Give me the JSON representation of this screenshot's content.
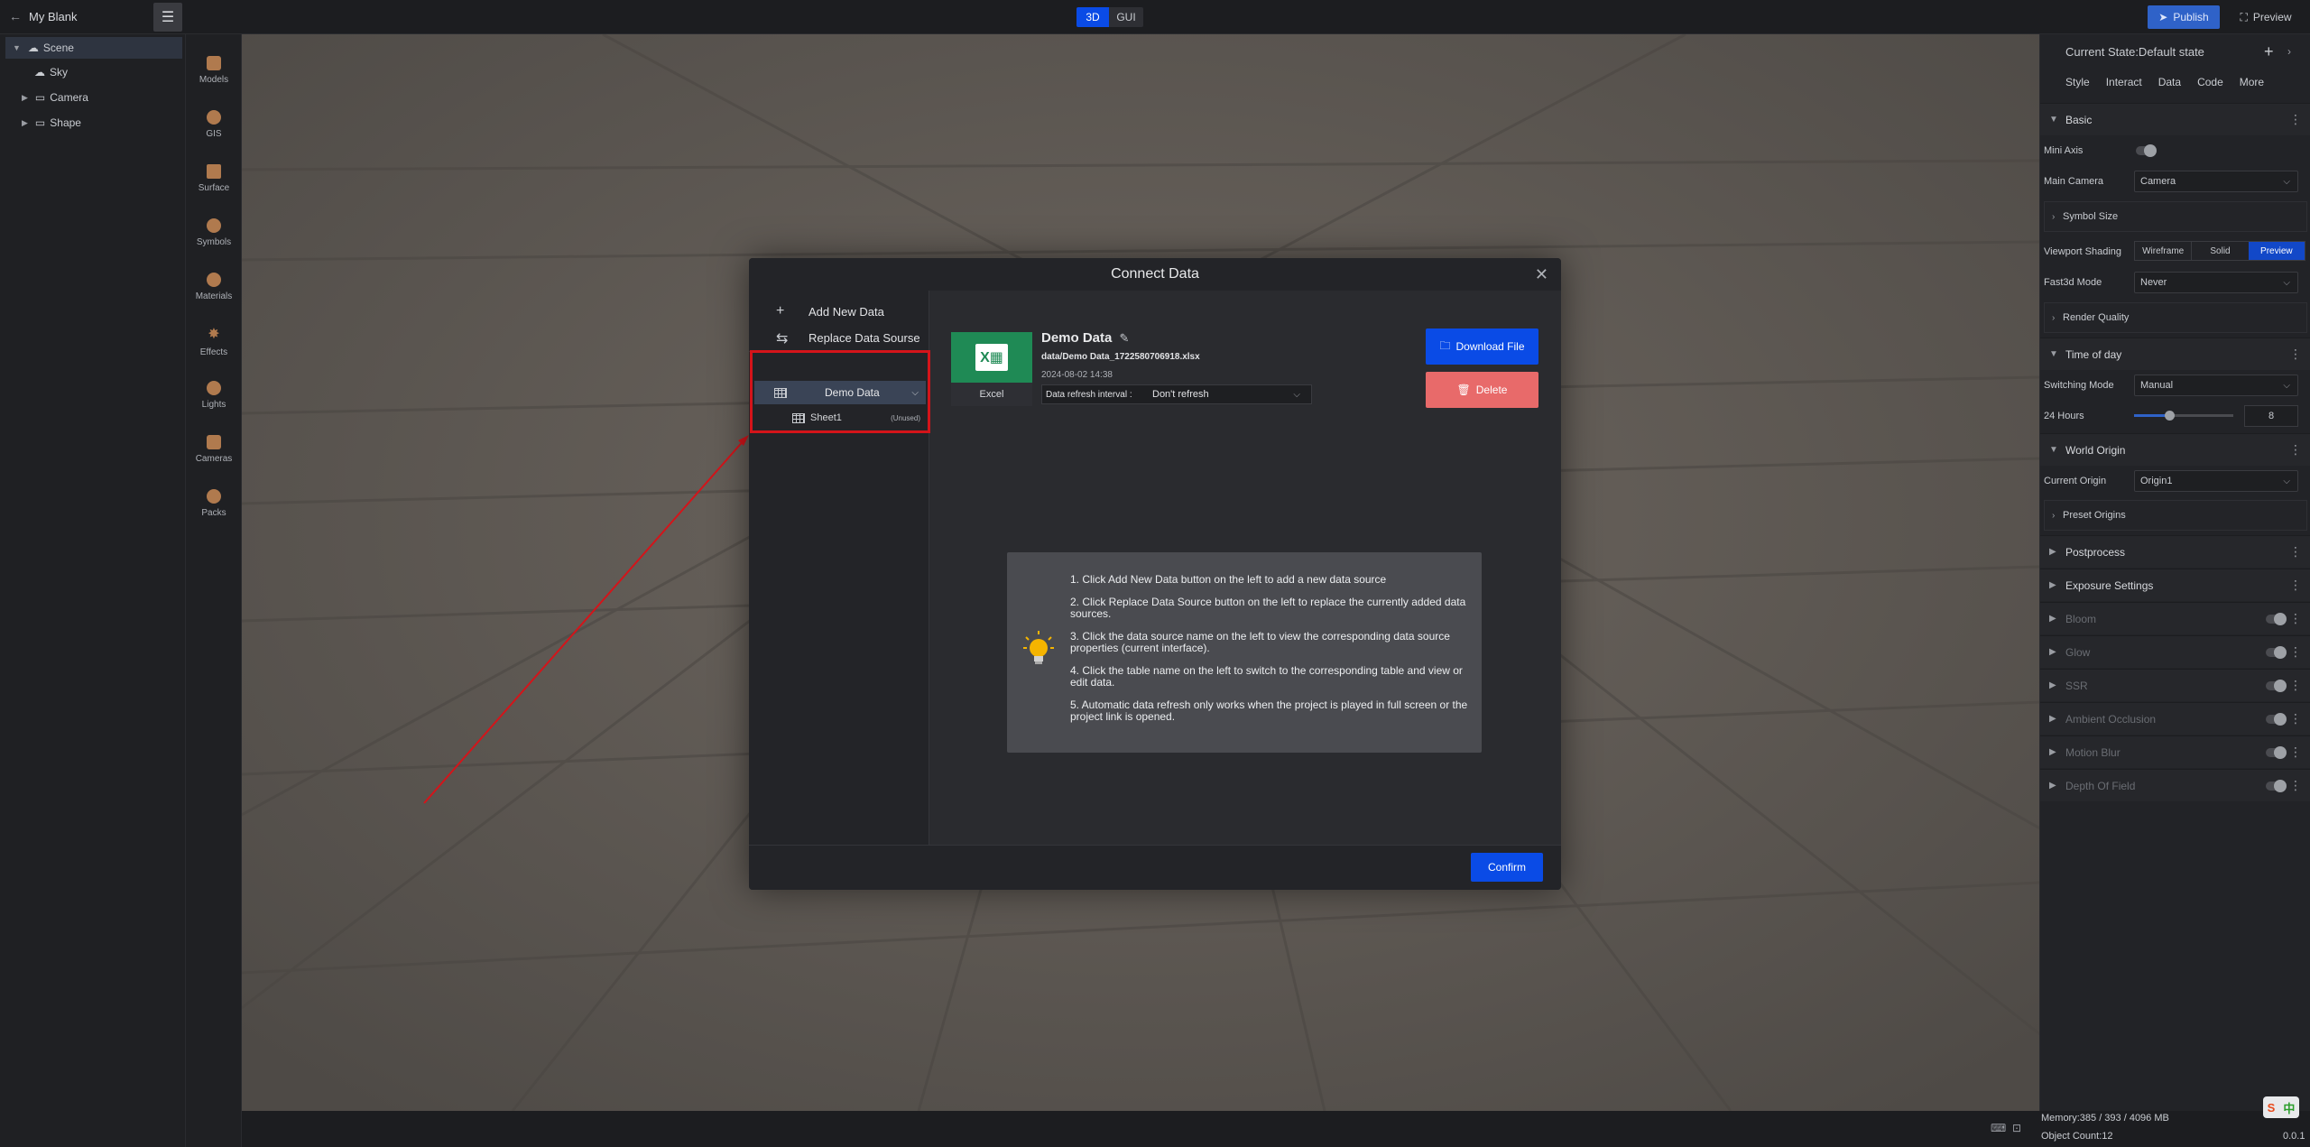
{
  "topbar": {
    "project_name": "My Blank",
    "mode_3d": "3D",
    "mode_gui": "GUI",
    "publish": "Publish",
    "preview": "Preview"
  },
  "scene_tree": {
    "items": [
      {
        "label": "Scene",
        "selected": true
      },
      {
        "label": "Sky"
      },
      {
        "label": "Camera"
      },
      {
        "label": "Shape"
      }
    ]
  },
  "asset_bar": {
    "items": [
      "Models",
      "GIS",
      "Surface",
      "Symbols",
      "Materials",
      "Effects",
      "Lights",
      "Cameras",
      "Packs"
    ]
  },
  "right_panel": {
    "state": "Current State:Default state",
    "tabs": [
      "Style",
      "Interact",
      "Data",
      "Code",
      "More"
    ],
    "basic": "Basic",
    "mini_axis": "Mini Axis",
    "main_camera_label": "Main Camera",
    "main_camera_value": "Camera",
    "symbol_size": "Symbol Size",
    "viewport_shading_label": "Viewport Shading",
    "shading_options": [
      "Wireframe",
      "Solid",
      "Preview"
    ],
    "fast3d_label": "Fast3d Mode",
    "fast3d_value": "Never",
    "render_quality": "Render Quality",
    "time_of_day": "Time of day",
    "switching_label": "Switching Mode",
    "switching_value": "Manual",
    "hours_label": "24 Hours",
    "hours_value": "8",
    "hours_level": 0.35,
    "world_origin": "World Origin",
    "current_origin_label": "Current Origin",
    "current_origin_value": "Origin1",
    "preset_origins": "Preset Origins",
    "postprocess": "Postprocess",
    "exposure": "Exposure Settings",
    "bloom": "Bloom",
    "glow": "Glow",
    "ssr": "SSR",
    "ao": "Ambient Occlusion",
    "motion_blur": "Motion Blur",
    "dof": "Depth Of Field"
  },
  "status": {
    "memory": "Memory:385 / 393 / 4096 MB",
    "object_count": "Object Count:12",
    "version": "0.0.1"
  },
  "modal": {
    "title": "Connect Data",
    "add_new": "Add New Data",
    "replace": "Replace Data Sourse",
    "source_name": "Demo Data",
    "sheet_name": "Sheet1",
    "sheet_status": "(Unused)",
    "file_type": "Excel",
    "data_title": "Demo Data",
    "file_path": "data/Demo Data_1722580706918.xlsx",
    "date": "2024-08-02 14:38",
    "refresh_label": "Data refresh interval :",
    "refresh_value": "Don't refresh",
    "download": "Download File",
    "delete": "Delete",
    "tips": [
      "1. Click Add New Data button on the left to add a new data source",
      "2. Click Replace Data Source button on the left to replace the currently added data sources.",
      "3. Click the data source name on the left to view the corresponding data source properties (current interface).",
      "4. Click the table name on the left to switch to the corresponding table and view or edit data.",
      "5. Automatic data refresh only works when the project is played in full screen or the project link is opened."
    ],
    "confirm": "Confirm"
  },
  "colors": {
    "accent": "#0a4be6",
    "delete": "#e86a6a",
    "excel": "#1f8a55",
    "annotation": "#d4141a"
  }
}
